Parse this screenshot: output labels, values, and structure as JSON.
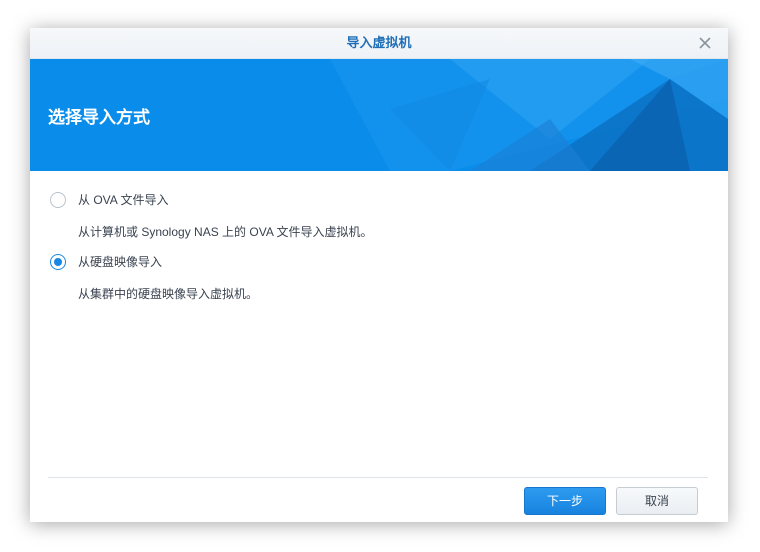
{
  "window": {
    "title": "导入虚拟机",
    "close_icon": "close-icon"
  },
  "banner": {
    "heading": "选择导入方式",
    "color": "#0a8ceb"
  },
  "options": [
    {
      "label": "从 OVA 文件导入",
      "description": "从计算机或 Synology NAS 上的 OVA 文件导入虚拟机。",
      "selected": false
    },
    {
      "label": "从硬盘映像导入",
      "description": "从集群中的硬盘映像导入虚拟机。",
      "selected": true
    }
  ],
  "footer": {
    "next_label": "下一步",
    "cancel_label": "取消"
  },
  "colors": {
    "accent": "#1a87e3",
    "title_text": "#1f6fb8"
  }
}
